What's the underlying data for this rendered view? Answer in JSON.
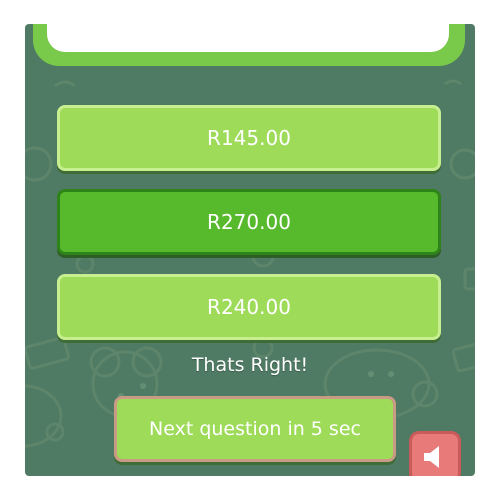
{
  "answers": [
    {
      "label": "R145.00",
      "state": "normal"
    },
    {
      "label": "R270.00",
      "state": "selected"
    },
    {
      "label": "R240.00",
      "state": "normal"
    }
  ],
  "feedback": "Thats Right!",
  "next_button": {
    "label": "Next question in 5 sec"
  },
  "sound_button": {
    "icon": "speaker-icon"
  },
  "colors": {
    "background": "#4f7a63",
    "answer_fill": "#9ddb59",
    "answer_selected_fill": "#57b92c",
    "sound_button_fill": "#e87a7a"
  }
}
